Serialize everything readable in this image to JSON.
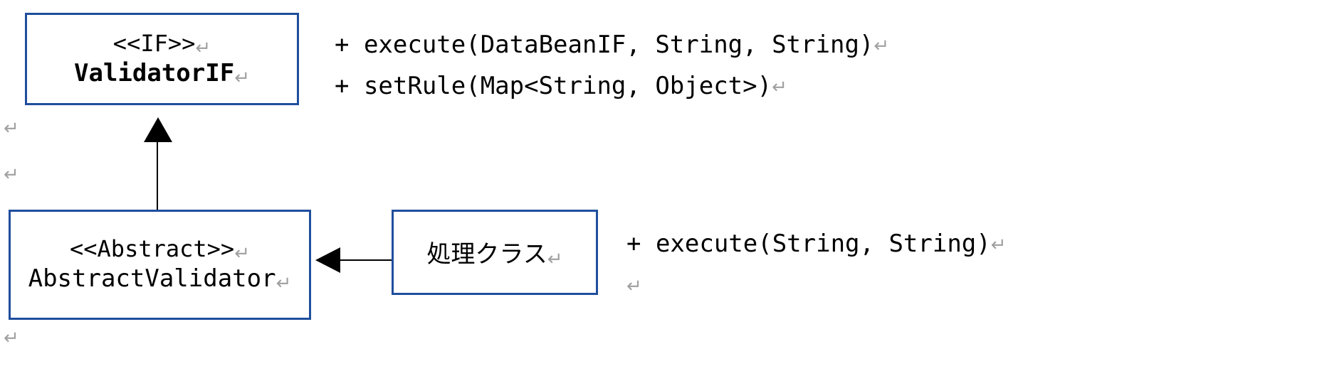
{
  "boxes": {
    "validator_if": {
      "stereotype": "<<IF>>",
      "name": "ValidatorIF"
    },
    "abstract_validator": {
      "stereotype": "<<Abstract>>",
      "name": "AbstractValidator"
    },
    "process_class": {
      "name": "処理クラス"
    }
  },
  "methods": {
    "validator_if": {
      "m1": "+ execute(DataBeanIF, String, String)",
      "m2": "+ setRule(Map<String, Object>)"
    },
    "process_class": {
      "m1": "+ execute(String, String)"
    }
  },
  "return_glyph": "↵"
}
